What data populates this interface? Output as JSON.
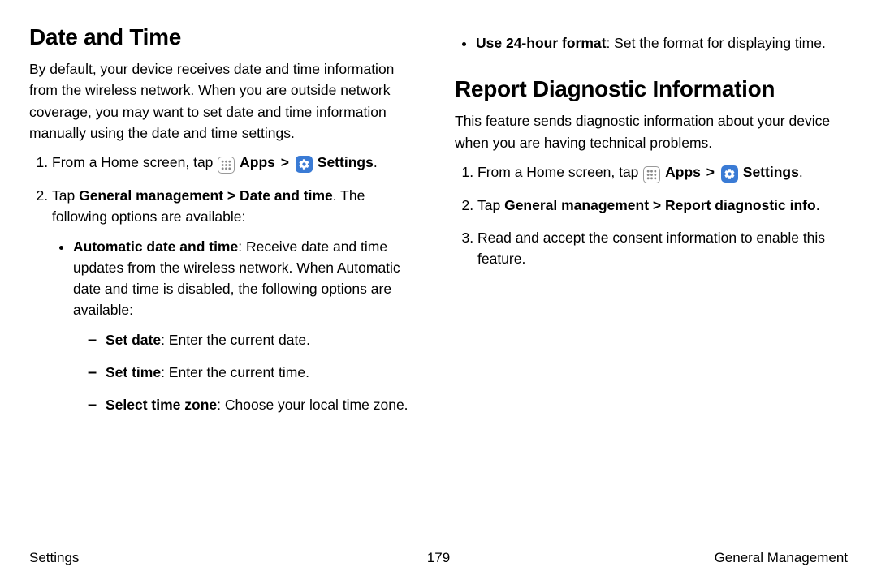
{
  "left": {
    "heading": "Date and Time",
    "intro": "By default, your device receives date and time information from the wireless network. When you are outside network coverage, you may want to set date and time information manually using the date and time settings.",
    "step1_prefix": "From a Home screen, tap ",
    "apps_label": "Apps",
    "settings_label": "Settings",
    "step2_prefix": "Tap ",
    "step2_bold": "General management > Date and time",
    "step2_suffix": ". The following options are available:",
    "auto_bold": "Automatic date and time",
    "auto_text": ": Receive date and time updates from the wireless network. When Automatic date and time is disabled, the following options are available:",
    "setdate_bold": "Set date",
    "setdate_text": ": Enter the current date.",
    "settime_bold": "Set time",
    "settime_text": ": Enter the current time.",
    "selecttz_bold": "Select time zone",
    "selecttz_text": ": Choose your local time zone."
  },
  "right_top": {
    "use24_bold": "Use 24-hour format",
    "use24_text": ": Set the format for displaying time."
  },
  "right": {
    "heading": "Report Diagnostic Information",
    "intro": "This feature sends diagnostic information about your device when you are having technical problems.",
    "step1_prefix": "From a Home screen, tap ",
    "apps_label": "Apps",
    "settings_label": "Settings",
    "step2_prefix": "Tap ",
    "step2_bold": "General management > Report diagnostic info",
    "step2_suffix": ".",
    "step3": "Read and accept the consent information to enable this feature."
  },
  "footer": {
    "left": "Settings",
    "center": "179",
    "right": "General Management"
  },
  "icons": {
    "apps": "apps-icon",
    "settings": "settings-icon"
  }
}
